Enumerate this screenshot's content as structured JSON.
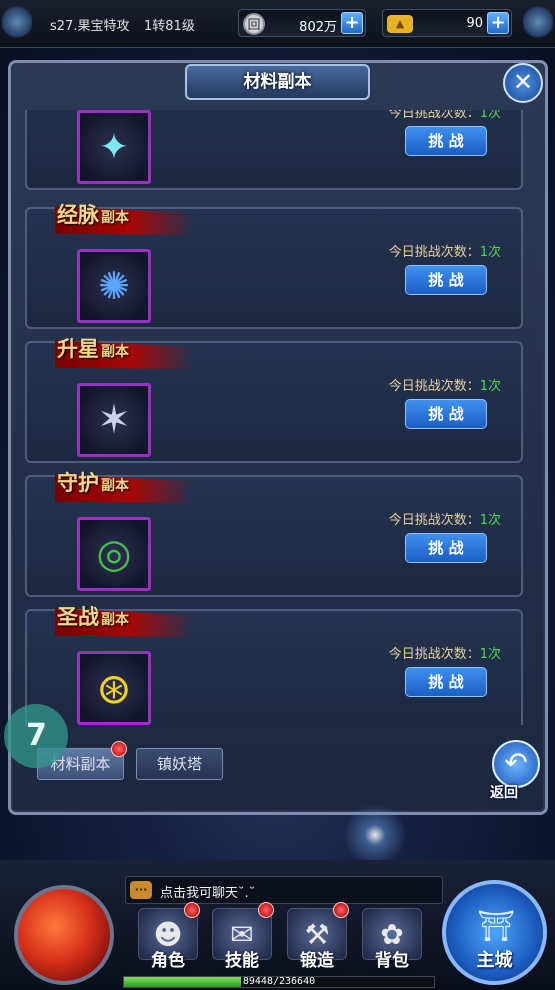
{
  "topbar": {
    "server": "s27.果宝特攻",
    "level": "1转81级",
    "silver": {
      "icon": "coin-icon",
      "value": "802万"
    },
    "gold": {
      "icon": "gold-ingot-icon",
      "value": "90"
    }
  },
  "panel": {
    "title": "材料副本",
    "close_icon": "close-icon"
  },
  "challenge_label": "今日挑战次数：",
  "dungeons": [
    {
      "name": "",
      "suffix": "",
      "icon": "crystal-icon",
      "count": "1次",
      "button": "挑 战",
      "glyph": "✦"
    },
    {
      "name": "经脉",
      "suffix": "副本",
      "icon": "meridian-orb-icon",
      "count": "1次",
      "button": "挑 战",
      "glyph": "✺"
    },
    {
      "name": "升星",
      "suffix": "副本",
      "icon": "star-shuriken-icon",
      "count": "1次",
      "button": "挑 战",
      "glyph": "✶"
    },
    {
      "name": "守护",
      "suffix": "副本",
      "icon": "jade-ring-icon",
      "count": "1次",
      "button": "挑 战",
      "glyph": "◎"
    },
    {
      "name": "圣战",
      "suffix": "副本",
      "icon": "golden-emblem-icon",
      "count": "1次",
      "button": "挑 战",
      "glyph": "⊛"
    }
  ],
  "tabs": [
    {
      "label": "材料副本",
      "active": true,
      "has_alert": true
    },
    {
      "label": "镇妖塔",
      "active": false,
      "has_alert": false
    }
  ],
  "float_badge": "7",
  "back": {
    "label": "返回",
    "icon": "return-arrow-icon"
  },
  "chat": {
    "icon": "chat-bubble-icon",
    "placeholder": "点击我可聊天˘.˘"
  },
  "menu": [
    {
      "label": "角色",
      "icon": "character-icon",
      "has_alert": true,
      "glyph": "☻"
    },
    {
      "label": "技能",
      "icon": "skill-book-icon",
      "has_alert": true,
      "glyph": "✉"
    },
    {
      "label": "锻造",
      "icon": "forge-icon",
      "has_alert": true,
      "glyph": "⚒"
    },
    {
      "label": "背包",
      "icon": "bag-icon",
      "has_alert": false,
      "glyph": "✿"
    }
  ],
  "main_city": {
    "label": "主城",
    "icon": "palace-icon"
  },
  "exp": {
    "text": "89448/236640",
    "fraction": 0.378
  }
}
